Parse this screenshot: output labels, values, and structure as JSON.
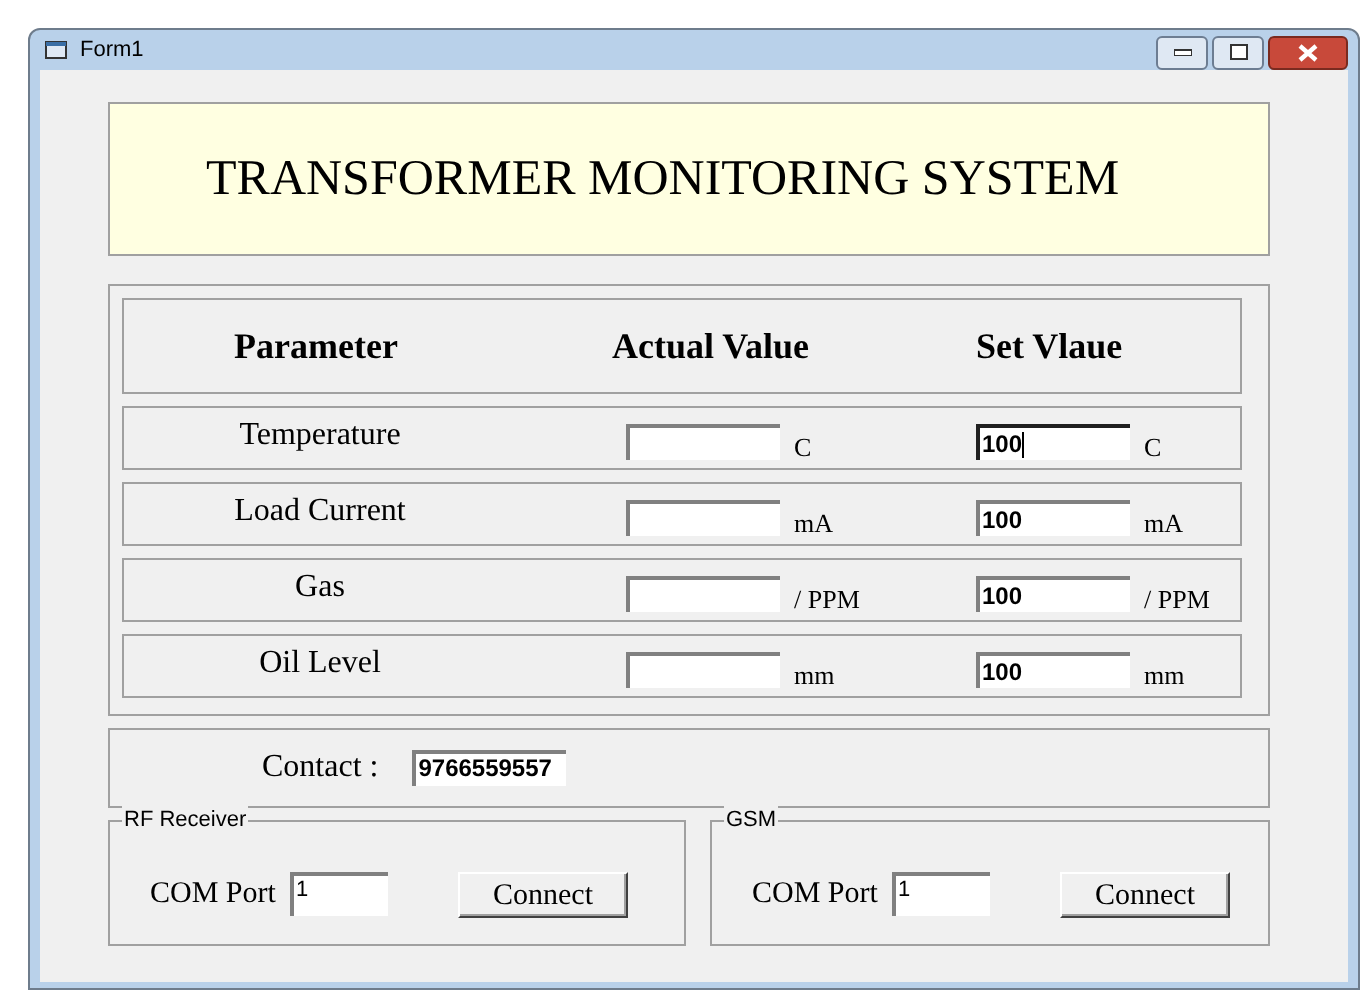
{
  "window": {
    "title": "Form1"
  },
  "banner": "TRANSFORMER MONITORING SYSTEM",
  "table": {
    "columns": [
      "Parameter",
      "Actual Value",
      "Set Vlaue"
    ],
    "rows": [
      {
        "parameter": "Temperature",
        "actual_unit": "C",
        "set_value": "100",
        "set_unit": "C",
        "focused": true
      },
      {
        "parameter": "Load Current",
        "actual_unit": "mA",
        "set_value": "100",
        "set_unit": "mA",
        "focused": false
      },
      {
        "parameter": "Gas",
        "actual_unit": "/ PPM",
        "set_value": "100",
        "set_unit": "/ PPM",
        "focused": false
      },
      {
        "parameter": "Oil Level",
        "actual_unit": "mm",
        "set_value": "100",
        "set_unit": "mm",
        "focused": false
      }
    ]
  },
  "contact": {
    "label": "Contact :",
    "value": "9766559557"
  },
  "groups": [
    {
      "title": "RF Receiver",
      "port_label": "COM Port",
      "port": "1",
      "button": "Connect"
    },
    {
      "title": "GSM",
      "port_label": "COM Port",
      "port": "1",
      "button": "Connect"
    }
  ]
}
